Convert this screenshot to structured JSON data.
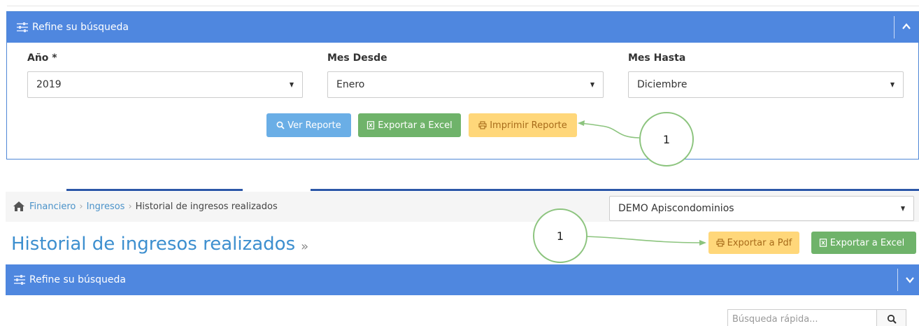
{
  "top_panel": {
    "title": "Refine su búsqueda",
    "fields": [
      {
        "label": "Año *",
        "value": "2019"
      },
      {
        "label": "Mes Desde",
        "value": "Enero"
      },
      {
        "label": "Mes Hasta",
        "value": "Diciembre"
      }
    ],
    "buttons": {
      "ver_reporte": "Ver Reporte",
      "exportar_excel": "Exportar a Excel",
      "imprimir_reporte": "Imprimir Reporte"
    }
  },
  "annotations": {
    "callout_top": "1",
    "callout_bottom": "1"
  },
  "breadcrumb": {
    "items": [
      "Financiero",
      "Ingresos"
    ],
    "current": "Historial de ingresos realizados"
  },
  "condominium_select": {
    "value": "DEMO Apiscondominios"
  },
  "page": {
    "title": "Historial de ingresos realizados",
    "raquo": "»"
  },
  "bottom_buttons": {
    "exportar_pdf": "Exportar a Pdf",
    "exportar_excel": "Exportar a Excel"
  },
  "bottom_panel": {
    "title": "Refine su búsqueda"
  },
  "search": {
    "placeholder": "Búsqueda rápida..."
  },
  "colors": {
    "panel_header": "#4f87df",
    "btn_info": "#6aaee6",
    "btn_success": "#6fb36a",
    "btn_warning": "#ffd77a",
    "callout_stroke": "#8cc47e",
    "title_blue": "#3d8fcf"
  }
}
